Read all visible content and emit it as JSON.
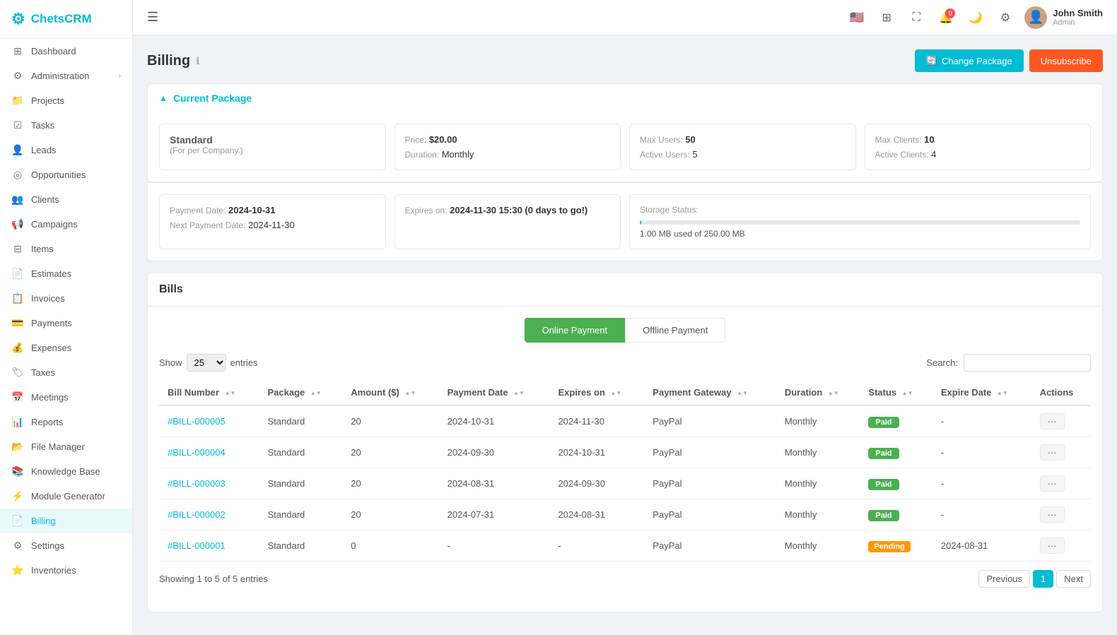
{
  "app": {
    "name": "ChetsCRM",
    "logo_symbol": "⚙"
  },
  "topbar": {
    "hamburger_label": "☰",
    "user": {
      "name": "John Smith",
      "role": "Admin"
    },
    "notification_count": "0"
  },
  "sidebar": {
    "items": [
      {
        "id": "dashboard",
        "label": "Dashboard",
        "icon": "⊞"
      },
      {
        "id": "administration",
        "label": "Administration",
        "icon": "⚙",
        "has_arrow": true
      },
      {
        "id": "projects",
        "label": "Projects",
        "icon": "📁"
      },
      {
        "id": "tasks",
        "label": "Tasks",
        "icon": "☑"
      },
      {
        "id": "leads",
        "label": "Leads",
        "icon": "👤"
      },
      {
        "id": "opportunities",
        "label": "Opportunities",
        "icon": "◎"
      },
      {
        "id": "clients",
        "label": "Clients",
        "icon": "👥"
      },
      {
        "id": "campaigns",
        "label": "Campaigns",
        "icon": "📢"
      },
      {
        "id": "items",
        "label": "Items",
        "icon": "⊟"
      },
      {
        "id": "estimates",
        "label": "Estimates",
        "icon": "📄"
      },
      {
        "id": "invoices",
        "label": "Invoices",
        "icon": "📋"
      },
      {
        "id": "payments",
        "label": "Payments",
        "icon": "💳"
      },
      {
        "id": "expenses",
        "label": "Expenses",
        "icon": "💰"
      },
      {
        "id": "taxes",
        "label": "Taxes",
        "icon": "🏷"
      },
      {
        "id": "meetings",
        "label": "Meetings",
        "icon": "📅"
      },
      {
        "id": "reports",
        "label": "Reports",
        "icon": "📊"
      },
      {
        "id": "file-manager",
        "label": "File Manager",
        "icon": "📂"
      },
      {
        "id": "knowledge-base",
        "label": "Knowledge Base",
        "icon": "📚"
      },
      {
        "id": "module-generator",
        "label": "Module Generator",
        "icon": "⚡"
      },
      {
        "id": "billing",
        "label": "Billing",
        "icon": "📄",
        "active": true
      },
      {
        "id": "settings",
        "label": "Settings",
        "icon": "⚙"
      },
      {
        "id": "inventories",
        "label": "Inventories",
        "icon": "⭐"
      }
    ]
  },
  "page": {
    "title": "Billing",
    "change_package_btn": "Change Package",
    "unsubscribe_btn": "Unsubscribe"
  },
  "current_package": {
    "section_title": "Current Package",
    "package_name": "Standard",
    "package_note": "(For per Company.)",
    "price_label": "Price:",
    "price_value": "$20.00",
    "duration_label": "Duration:",
    "duration_value": "Monthly",
    "max_users_label": "Max Users:",
    "max_users_value": "50",
    "active_users_label": "Active Users:",
    "active_users_value": "5",
    "max_clients_label": "Max Clients:",
    "max_clients_value": "10",
    "active_clients_label": "Active Clients:",
    "active_clients_value": "4",
    "payment_date_label": "Payment Date:",
    "payment_date_value": "2024-10-31",
    "next_payment_label": "Next Payment Date:",
    "next_payment_value": "2024-11-30",
    "expires_label": "Expires on:",
    "expires_value": "2024-11-30 15:30 (0 days to go!)",
    "storage_label": "Storage Status:",
    "storage_used": "1.00 MB used of 250.00 MB",
    "storage_pct": 0.4
  },
  "bills": {
    "section_title": "Bills",
    "online_payment_btn": "Online Payment",
    "offline_payment_btn": "Offline Payment",
    "show_label": "Show",
    "entries_label": "entries",
    "search_label": "Search:",
    "show_value": "25",
    "showing_text": "Showing 1 to 5 of 5 entries",
    "columns": [
      "Bill Number",
      "Package",
      "Amount ($)",
      "Payment Date",
      "Expires on",
      "Payment Gateway",
      "Duration",
      "Status",
      "Expire Date",
      "Actions"
    ],
    "rows": [
      {
        "bill_number": "#BILL-000005",
        "package": "Standard",
        "amount": "20",
        "payment_date": "2024-10-31",
        "expires_on": "2024-11-30",
        "gateway": "PayPal",
        "duration": "Monthly",
        "status": "Paid",
        "expire_date": "-"
      },
      {
        "bill_number": "#BILL-000004",
        "package": "Standard",
        "amount": "20",
        "payment_date": "2024-09-30",
        "expires_on": "2024-10-31",
        "gateway": "PayPal",
        "duration": "Monthly",
        "status": "Paid",
        "expire_date": "-"
      },
      {
        "bill_number": "#BILL-000003",
        "package": "Standard",
        "amount": "20",
        "payment_date": "2024-08-31",
        "expires_on": "2024-09-30",
        "gateway": "PayPal",
        "duration": "Monthly",
        "status": "Paid",
        "expire_date": "-"
      },
      {
        "bill_number": "#BILL-000002",
        "package": "Standard",
        "amount": "20",
        "payment_date": "2024-07-31",
        "expires_on": "2024-08-31",
        "gateway": "PayPal",
        "duration": "Monthly",
        "status": "Paid",
        "expire_date": "-"
      },
      {
        "bill_number": "#BILL-000001",
        "package": "Standard",
        "amount": "0",
        "payment_date": "-",
        "expires_on": "-",
        "gateway": "PayPal",
        "duration": "Monthly",
        "status": "Pending",
        "expire_date": "2024-08-31"
      }
    ],
    "pagination": {
      "previous": "Previous",
      "next": "Next",
      "current_page": "1"
    }
  }
}
